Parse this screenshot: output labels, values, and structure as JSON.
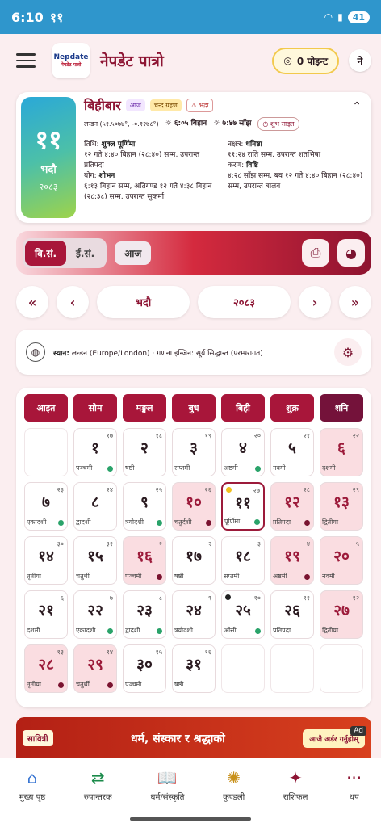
{
  "status": {
    "time": "6:10",
    "extra": "११",
    "battery": "41"
  },
  "app": {
    "logo": "Nepdate",
    "logo_sub": "नेपडेट पात्रो",
    "title": "नेपडेट पात्रो",
    "points": "0 पोइन्ट",
    "avatar": "ने"
  },
  "day": {
    "big_num": "११",
    "big_month": "भदौ",
    "big_year": "२०८३",
    "weekday": "बिहीबार",
    "today_tag": "आज",
    "eclipse_tag": "चन्द्र ग्रहण",
    "bhadra_tag": "भद्रा",
    "location": "लन्डन (५१.५०७४°, -०.१२७८°)",
    "sunrise": "६:०५ बिहान",
    "sunset": "७:४७ साँझ",
    "shubh": "शुभ साइत",
    "tithi_label": "तिथि:",
    "tithi": "शुक्ल पूर्णिमा",
    "tithi_detail": "१२ गते ४:४० बिहान (२८:४०) सम्म, उपरान्त प्रतिपदा",
    "yoga_label": "योग:",
    "yoga": "शोभन",
    "yoga_detail": "६:१३ बिहान सम्म, अतिगण्ड १२ गते ४:३८ बिहान (२८:३८) सम्म, उपरान्त सुकर्मा",
    "nakshatra_label": "नक्षत्र:",
    "nakshatra": "धनिष्ठा",
    "nakshatra_detail": "११:२४ राति सम्म, उपरान्त शतभिषा",
    "karan_label": "करण:",
    "karan": "विष्टि",
    "karan_detail": "४:२८ साँझ सम्म, बव १२ गते ४:४० बिहान (२८:४०) सम्म, उपरान्त बालव"
  },
  "toolbar": {
    "bs": "वि.सं.",
    "ad": "ई.सं.",
    "today": "आज"
  },
  "nav": {
    "month": "भदौ",
    "year": "२०८३"
  },
  "loc": {
    "label": "स्थान:",
    "value": "लन्डन (Europe/London) · गणना इन्जिन: सूर्य सिद्धान्त (परम्परागत)"
  },
  "weekdays": [
    "आइत",
    "सोम",
    "मङ्गल",
    "बुध",
    "बिही",
    "शुक्र",
    "शनि"
  ],
  "days": [
    {
      "n": "",
      "e": "",
      "t": ""
    },
    {
      "n": "१",
      "e": "१७",
      "t": "पञ्चमी",
      "dot": "g"
    },
    {
      "n": "२",
      "e": "१८",
      "t": "षष्ठी"
    },
    {
      "n": "३",
      "e": "१९",
      "t": "सप्तमी"
    },
    {
      "n": "४",
      "e": "२०",
      "t": "अष्टमी",
      "dot": "g"
    },
    {
      "n": "५",
      "e": "२१",
      "t": "नवमी"
    },
    {
      "n": "६",
      "e": "२२",
      "t": "दशमी",
      "sat": true
    },
    {
      "n": "७",
      "e": "२३",
      "t": "एकादशी",
      "dot": "g"
    },
    {
      "n": "८",
      "e": "२४",
      "t": "द्वादशी"
    },
    {
      "n": "९",
      "e": "२५",
      "t": "त्रयोदशी",
      "dot": "g"
    },
    {
      "n": "१०",
      "e": "२६",
      "t": "चतुर्दशी",
      "hol": true,
      "dot": "m"
    },
    {
      "n": "११",
      "e": "२७",
      "t": "पूर्णिमा",
      "today": true,
      "dot": "g",
      "tl": "#f2c01e"
    },
    {
      "n": "१२",
      "e": "२८",
      "t": "प्रतिपदा",
      "hol": true,
      "dot": "m"
    },
    {
      "n": "१३",
      "e": "२९",
      "t": "द्वितीया",
      "sat": true
    },
    {
      "n": "१४",
      "e": "३०",
      "t": "तृतीया"
    },
    {
      "n": "१५",
      "e": "३१",
      "t": "चतुर्थी"
    },
    {
      "n": "१६",
      "e": "१",
      "t": "पञ्चमी",
      "hol": true,
      "dot": "m"
    },
    {
      "n": "१७",
      "e": "२",
      "t": "षष्ठी"
    },
    {
      "n": "१८",
      "e": "३",
      "t": "सप्तमी"
    },
    {
      "n": "१९",
      "e": "४",
      "t": "अष्टमी",
      "hol": true,
      "dot": "m"
    },
    {
      "n": "२०",
      "e": "५",
      "t": "नवमी",
      "sat": true
    },
    {
      "n": "२१",
      "e": "६",
      "t": "दशमी"
    },
    {
      "n": "२२",
      "e": "७",
      "t": "एकादशी",
      "dot": "g"
    },
    {
      "n": "२३",
      "e": "८",
      "t": "द्वादशी",
      "dot": "g"
    },
    {
      "n": "२४",
      "e": "९",
      "t": "त्रयोदशी"
    },
    {
      "n": "२५",
      "e": "१०",
      "t": "औंसी",
      "dot": "g",
      "tl": "#222"
    },
    {
      "n": "२६",
      "e": "११",
      "t": "प्रतिपदा"
    },
    {
      "n": "२७",
      "e": "१२",
      "t": "द्वितीया",
      "sat": true
    },
    {
      "n": "२८",
      "e": "१३",
      "t": "तृतीया",
      "hol": true,
      "dot": "m"
    },
    {
      "n": "२९",
      "e": "१४",
      "t": "चतुर्थी",
      "hol": true,
      "dot": "m"
    },
    {
      "n": "३०",
      "e": "१५",
      "t": "पञ्चमी"
    },
    {
      "n": "३१",
      "e": "१६",
      "t": "षष्ठी"
    },
    {
      "n": "",
      "e": "",
      "t": ""
    },
    {
      "n": "",
      "e": "",
      "t": ""
    },
    {
      "n": "",
      "e": "",
      "t": ""
    }
  ],
  "ad": {
    "left": "सावित्री",
    "text": "धर्म, संस्कार र श्रद्धाको",
    "button": "आजै अर्डर गर्नुहोस्",
    "tag": "Ad"
  },
  "bottom": [
    {
      "label": "मुख्य पृष्ठ",
      "icon": "home-icon",
      "glyph": "⌂"
    },
    {
      "label": "रुपान्तरक",
      "icon": "convert-icon",
      "glyph": "⇄"
    },
    {
      "label": "धर्म/संस्कृति",
      "icon": "book-icon",
      "glyph": "📖"
    },
    {
      "label": "कुण्डली",
      "icon": "kundali-icon",
      "glyph": "✺"
    },
    {
      "label": "राशिफल",
      "icon": "wand-icon",
      "glyph": "✦"
    },
    {
      "label": "थप",
      "icon": "more-icon",
      "glyph": "···"
    }
  ]
}
